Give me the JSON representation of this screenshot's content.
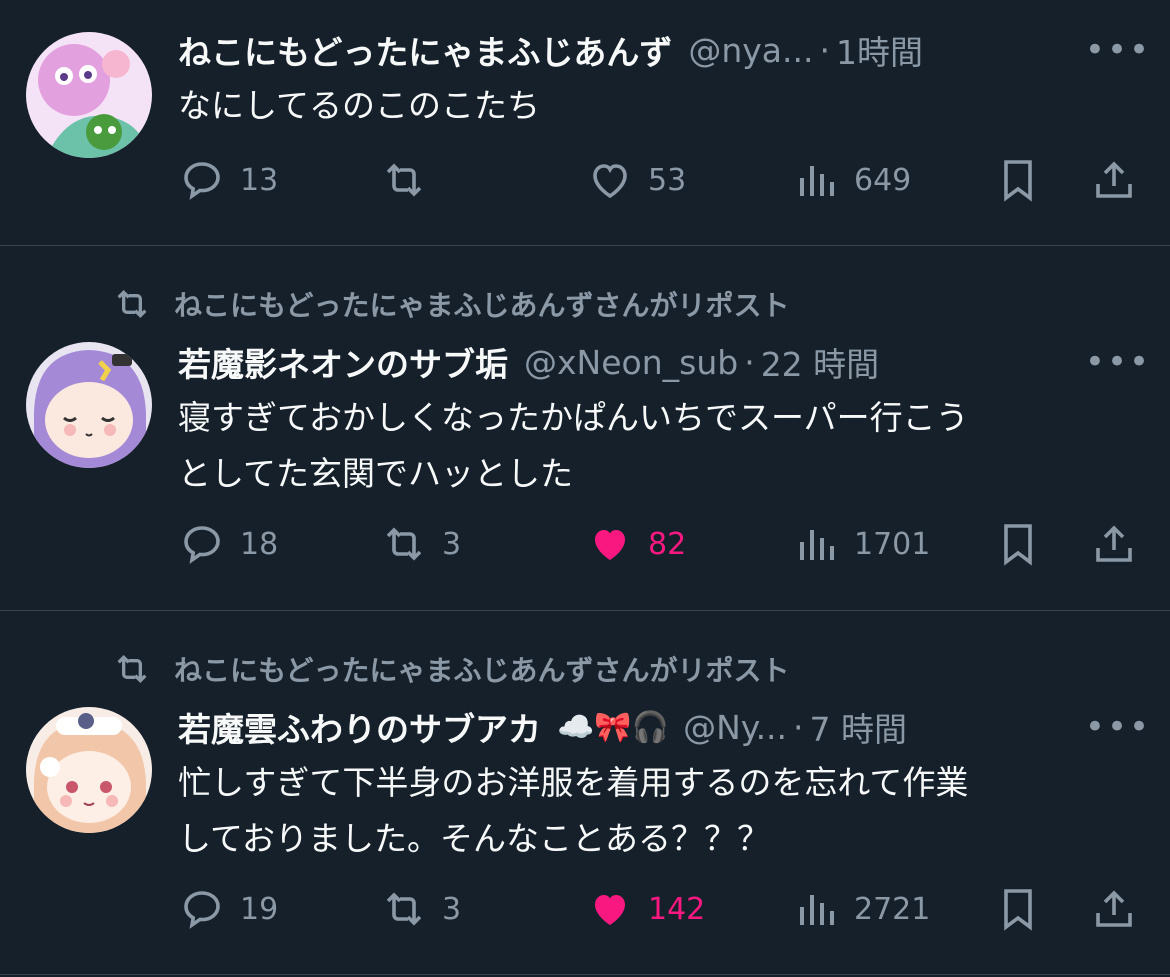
{
  "colors": {
    "background": "#15202b",
    "text": "#f7f9f9",
    "secondary": "#8b98a5",
    "like": "#f91880",
    "divider": "#38444d"
  },
  "tweets": [
    {
      "name": "ねこにもどったにゃまふじあんず",
      "handle": "@nya...",
      "dot": "·",
      "time": "1時間",
      "more": "•••",
      "body": "なにしてるのこのこたち",
      "reply_count": "13",
      "retweet_count": "",
      "like_count": "53",
      "view_count": "649",
      "liked": false
    },
    {
      "repost_text": "ねこにもどったにゃまふじあんずさんがリポスト",
      "name": "若魔影ネオンのサブ垢",
      "handle": "@xNeon_sub",
      "dot": "·",
      "time": "22 時間",
      "more": "•••",
      "body_line1": "寝すぎておかしくなったかぱんいちでスーパー行こう",
      "body_line2": "としてた玄関でハッとした",
      "reply_count": "18",
      "retweet_count": "3",
      "like_count": "82",
      "view_count": "1701",
      "liked": true
    },
    {
      "repost_text": "ねこにもどったにゃまふじあんずさんがリポスト",
      "name": "若魔雲ふわりのサブアカ",
      "name_emojis": "☁️🎀🎧",
      "handle": "@Ny...",
      "dot": "·",
      "time": "7 時間",
      "more": "•••",
      "body_line1": "忙しすぎて下半身のお洋服を着用するのを忘れて作業",
      "body_line2": "しておりました。そんなことある？？？",
      "reply_count": "19",
      "retweet_count": "3",
      "like_count": "142",
      "view_count": "2721",
      "liked": true
    }
  ],
  "icons": [
    "reply-icon",
    "retweet-icon",
    "like-icon",
    "views-icon",
    "bookmark-icon",
    "share-icon",
    "repost-indicator-icon",
    "more-icon"
  ]
}
